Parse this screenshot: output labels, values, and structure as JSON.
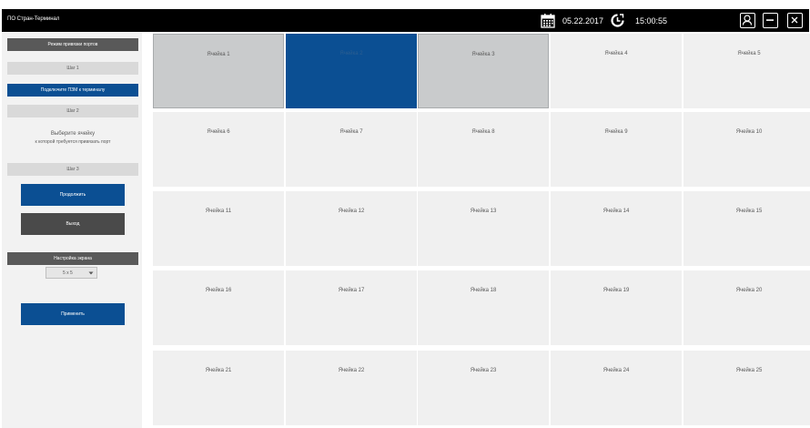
{
  "app": {
    "title": "ПО Стран-Терминал"
  },
  "topbar": {
    "date": "05.22.2017",
    "time": "15:00:55",
    "icons": {
      "calendar": "calendar-icon",
      "clock": "clock-icon",
      "user": "user-icon",
      "minimize": "minimize-icon",
      "close": "close-icon"
    }
  },
  "sidebar": {
    "mode_header": "Режим привязки портов",
    "step1": "Шаг 1",
    "connect": "Подключите ПЗМ к терминалу",
    "step2": "Шаг 2",
    "instruction_line1": "Выберите ячейку",
    "instruction_line2": "к которой требуется привязать порт",
    "step3": "Шаг 3",
    "continue_label": "Продолжить",
    "exit_label": "Выход",
    "screen_settings": "Настройка экрана",
    "grid_select_value": "5 x 5",
    "apply_label": "Применить"
  },
  "colors": {
    "accent_blue": "#0b4f93",
    "dark_grey": "#595959",
    "cell_bg": "#f0f0f0",
    "cell_selected_grey": "#c9cbcc"
  },
  "grid": {
    "cells": [
      {
        "label": "Ячейка 1",
        "state": "grey"
      },
      {
        "label": "Ячейка 2",
        "state": "blue"
      },
      {
        "label": "Ячейка 3",
        "state": "grey"
      },
      {
        "label": "Ячейка 4",
        "state": "normal"
      },
      {
        "label": "Ячейка 5",
        "state": "normal"
      },
      {
        "label": "Ячейка 6",
        "state": "normal"
      },
      {
        "label": "Ячейка 7",
        "state": "normal"
      },
      {
        "label": "Ячейка 8",
        "state": "normal"
      },
      {
        "label": "Ячейка 9",
        "state": "normal"
      },
      {
        "label": "Ячейка 10",
        "state": "normal"
      },
      {
        "label": "Ячейка 11",
        "state": "normal"
      },
      {
        "label": "Ячейка 12",
        "state": "normal"
      },
      {
        "label": "Ячейка 13",
        "state": "normal"
      },
      {
        "label": "Ячейка 14",
        "state": "normal"
      },
      {
        "label": "Ячейка 15",
        "state": "normal"
      },
      {
        "label": "Ячейка 16",
        "state": "normal"
      },
      {
        "label": "Ячейка 17",
        "state": "normal"
      },
      {
        "label": "Ячейка 18",
        "state": "normal"
      },
      {
        "label": "Ячейка 19",
        "state": "normal"
      },
      {
        "label": "Ячейка 20",
        "state": "normal"
      },
      {
        "label": "Ячейка 21",
        "state": "normal"
      },
      {
        "label": "Ячейка 22",
        "state": "normal"
      },
      {
        "label": "Ячейка 23",
        "state": "normal"
      },
      {
        "label": "Ячейка 24",
        "state": "normal"
      },
      {
        "label": "Ячейка 25",
        "state": "normal"
      }
    ]
  }
}
